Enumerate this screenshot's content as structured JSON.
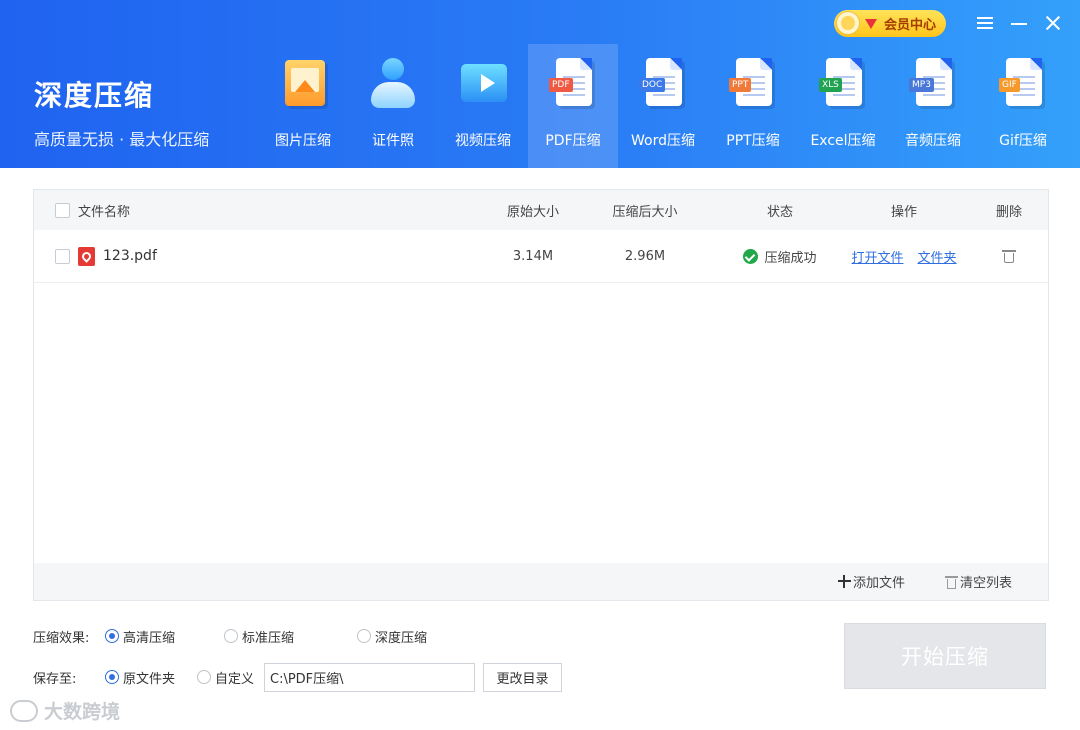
{
  "brand": {
    "title": "深度压缩",
    "subtitle": "高质量无损 · 最大化压缩"
  },
  "window": {
    "vip_label": "会员中心",
    "icons": [
      "vip-avatar-icon",
      "diamond-icon",
      "menu-icon",
      "minimize-icon",
      "close-icon"
    ]
  },
  "tools": [
    {
      "label": "图片压缩",
      "icon": "image-compress-icon",
      "active": false
    },
    {
      "label": "证件照",
      "icon": "id-photo-icon",
      "active": false
    },
    {
      "label": "视频压缩",
      "icon": "video-compress-icon",
      "active": false
    },
    {
      "label": "PDF压缩",
      "icon": "pdf-compress-icon",
      "tag": "PDF",
      "tag_color": "#f05a45",
      "active": true
    },
    {
      "label": "Word压缩",
      "icon": "word-compress-icon",
      "tag": "DOC",
      "tag_color": "#3b7ae8",
      "active": false
    },
    {
      "label": "PPT压缩",
      "icon": "ppt-compress-icon",
      "tag": "PPT",
      "tag_color": "#f07a3a",
      "active": false
    },
    {
      "label": "Excel压缩",
      "icon": "excel-compress-icon",
      "tag": "XLS",
      "tag_color": "#22a352",
      "active": false
    },
    {
      "label": "音频压缩",
      "icon": "audio-compress-icon",
      "tag": "MP3",
      "tag_color": "#4a78d8",
      "active": false
    },
    {
      "label": "Gif压缩",
      "icon": "gif-compress-icon",
      "tag": "GIF",
      "tag_color": "#f59a2a",
      "active": false
    }
  ],
  "table": {
    "headers": {
      "name": "文件名称",
      "original_size": "原始大小",
      "compressed_size": "压缩后大小",
      "status": "状态",
      "action": "操作",
      "delete": "删除"
    },
    "rows": [
      {
        "file_name": "123.pdf",
        "original_size": "3.14M",
        "compressed_size": "2.96M",
        "status": "压缩成功",
        "open_file": "打开文件",
        "open_folder": "文件夹"
      }
    ],
    "footer": {
      "add_file": "添加文件",
      "clear_list": "清空列表"
    }
  },
  "options": {
    "effect_label": "压缩效果:",
    "effect_choices": [
      "高清压缩",
      "标准压缩",
      "深度压缩"
    ],
    "effect_selected": "高清压缩",
    "save_label": "保存至:",
    "save_choices": [
      "原文件夹",
      "自定义"
    ],
    "save_selected": "原文件夹",
    "path_value": "C:\\PDF压缩\\",
    "change_dir": "更改目录",
    "start": "开始压缩"
  },
  "watermark": {
    "text": "大数跨境"
  },
  "colors": {
    "header_start": "#1f63f0",
    "header_end": "#34a0fb",
    "link": "#2f6fe0",
    "success": "#20a84a",
    "vip": "#ffc51a"
  }
}
